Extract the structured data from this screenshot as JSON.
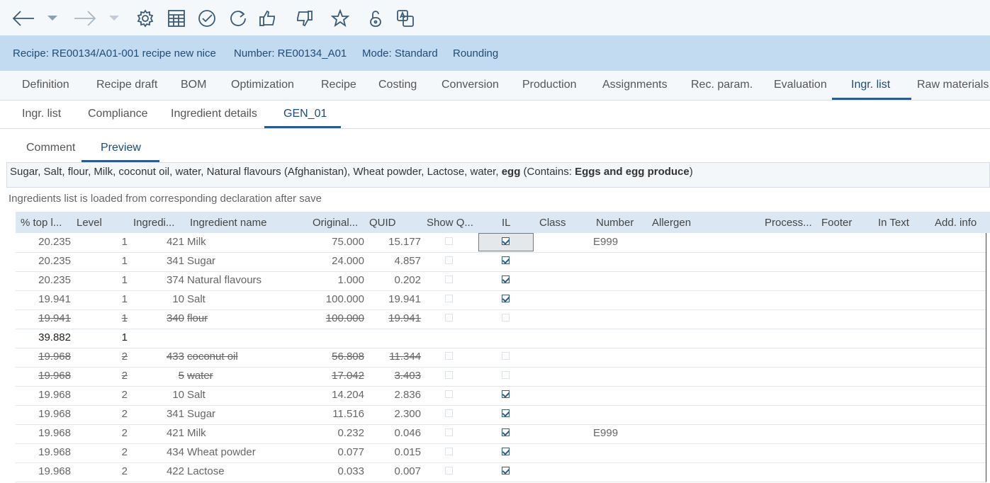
{
  "toolbar": {
    "icons": [
      "back-arrow-icon",
      "dropdown-icon",
      "forward-arrow-icon",
      "dropdown-icon",
      "gear-icon",
      "calculator-icon",
      "check-circle-icon",
      "refresh-icon",
      "thumbs-up-icon",
      "thumbs-down-icon",
      "star-icon",
      "lock-icon",
      "translate-icon"
    ]
  },
  "header": {
    "recipe": "Recipe:  RE00134/A01-001  recipe new  nice",
    "number": "Number:  RE00134_A01",
    "mode": "Mode: Standard",
    "rounding": "Rounding"
  },
  "tabs_main": [
    "Definition",
    "Recipe draft",
    "BOM",
    "Optimization",
    "Recipe",
    "Costing",
    "Conversion",
    "Production",
    "Assignments",
    "Rec. param.",
    "Evaluation",
    "Ingr. list",
    "Raw materials"
  ],
  "tabs_main_active": "Ingr. list",
  "tabs_sub": [
    "Ingr. list",
    "Compliance",
    "Ingredient details",
    "GEN_01"
  ],
  "tabs_sub_active": "GEN_01",
  "tabs_preview": [
    "Comment",
    "Preview"
  ],
  "tabs_preview_active": "Preview",
  "preview": {
    "text_plain": "Sugar, Salt, flour, Milk, coconut oil, water, Natural flavours (Afghanistan), Wheat powder, Lactose, water, ",
    "egg": "egg",
    "contains_open": " (Contains: ",
    "contains_bold": "Eggs and egg produce",
    "contains_close": ")"
  },
  "note": "Ingredients list is loaded from corresponding declaration after save",
  "table": {
    "headers": [
      "% top l...",
      "Level",
      "Ingredi...",
      "Ingredient name",
      "Original...",
      "QUID",
      "Show Q...",
      "IL",
      "Class",
      "Number",
      "Allergen",
      "Process...",
      "Footer",
      "In Text",
      "Add. info"
    ],
    "rows": [
      {
        "pct": "20.235",
        "level": "1",
        "ing": "421",
        "name": "Milk",
        "orig": "75.000",
        "quid": "15.177",
        "il": true,
        "number": "E999",
        "strike": false
      },
      {
        "pct": "20.235",
        "level": "1",
        "ing": "341",
        "name": "Sugar",
        "orig": "24.000",
        "quid": "4.857",
        "il": true,
        "number": "",
        "strike": false
      },
      {
        "pct": "20.235",
        "level": "1",
        "ing": "374",
        "name": "Natural flavours",
        "orig": "1.000",
        "quid": "0.202",
        "il": true,
        "number": "",
        "strike": false
      },
      {
        "pct": "19.941",
        "level": "1",
        "ing": "10",
        "name": "Salt",
        "orig": "100.000",
        "quid": "19.941",
        "il": true,
        "number": "",
        "strike": false
      },
      {
        "pct": "19.941",
        "level": "1",
        "ing": "340",
        "name": "flour",
        "orig": "100.000",
        "quid": "19.941",
        "il": false,
        "number": "",
        "strike": true
      },
      {
        "pct": "39.882",
        "level": "1",
        "ing": "",
        "name": "",
        "orig": "",
        "quid": "",
        "il": null,
        "number": "",
        "strike": false,
        "bold": true
      },
      {
        "pct": "19.968",
        "level": "2",
        "ing": "433",
        "name": "coconut oil",
        "orig": "56.808",
        "quid": "11.344",
        "il": false,
        "number": "",
        "strike": true
      },
      {
        "pct": "19.968",
        "level": "2",
        "ing": "5",
        "name": "water",
        "orig": "17.042",
        "quid": "3.403",
        "il": false,
        "number": "",
        "strike": true
      },
      {
        "pct": "19.968",
        "level": "2",
        "ing": "10",
        "name": "Salt",
        "orig": "14.204",
        "quid": "2.836",
        "il": true,
        "number": "",
        "strike": false
      },
      {
        "pct": "19.968",
        "level": "2",
        "ing": "341",
        "name": "Sugar",
        "orig": "11.516",
        "quid": "2.300",
        "il": true,
        "number": "",
        "strike": false
      },
      {
        "pct": "19.968",
        "level": "2",
        "ing": "421",
        "name": "Milk",
        "orig": "0.232",
        "quid": "0.046",
        "il": true,
        "number": "E999",
        "strike": false
      },
      {
        "pct": "19.968",
        "level": "2",
        "ing": "434",
        "name": "Wheat powder",
        "orig": "0.077",
        "quid": "0.015",
        "il": true,
        "number": "",
        "strike": false
      },
      {
        "pct": "19.968",
        "level": "2",
        "ing": "422",
        "name": "Lactose",
        "orig": "0.033",
        "quid": "0.007",
        "il": true,
        "number": "",
        "strike": false
      }
    ]
  }
}
